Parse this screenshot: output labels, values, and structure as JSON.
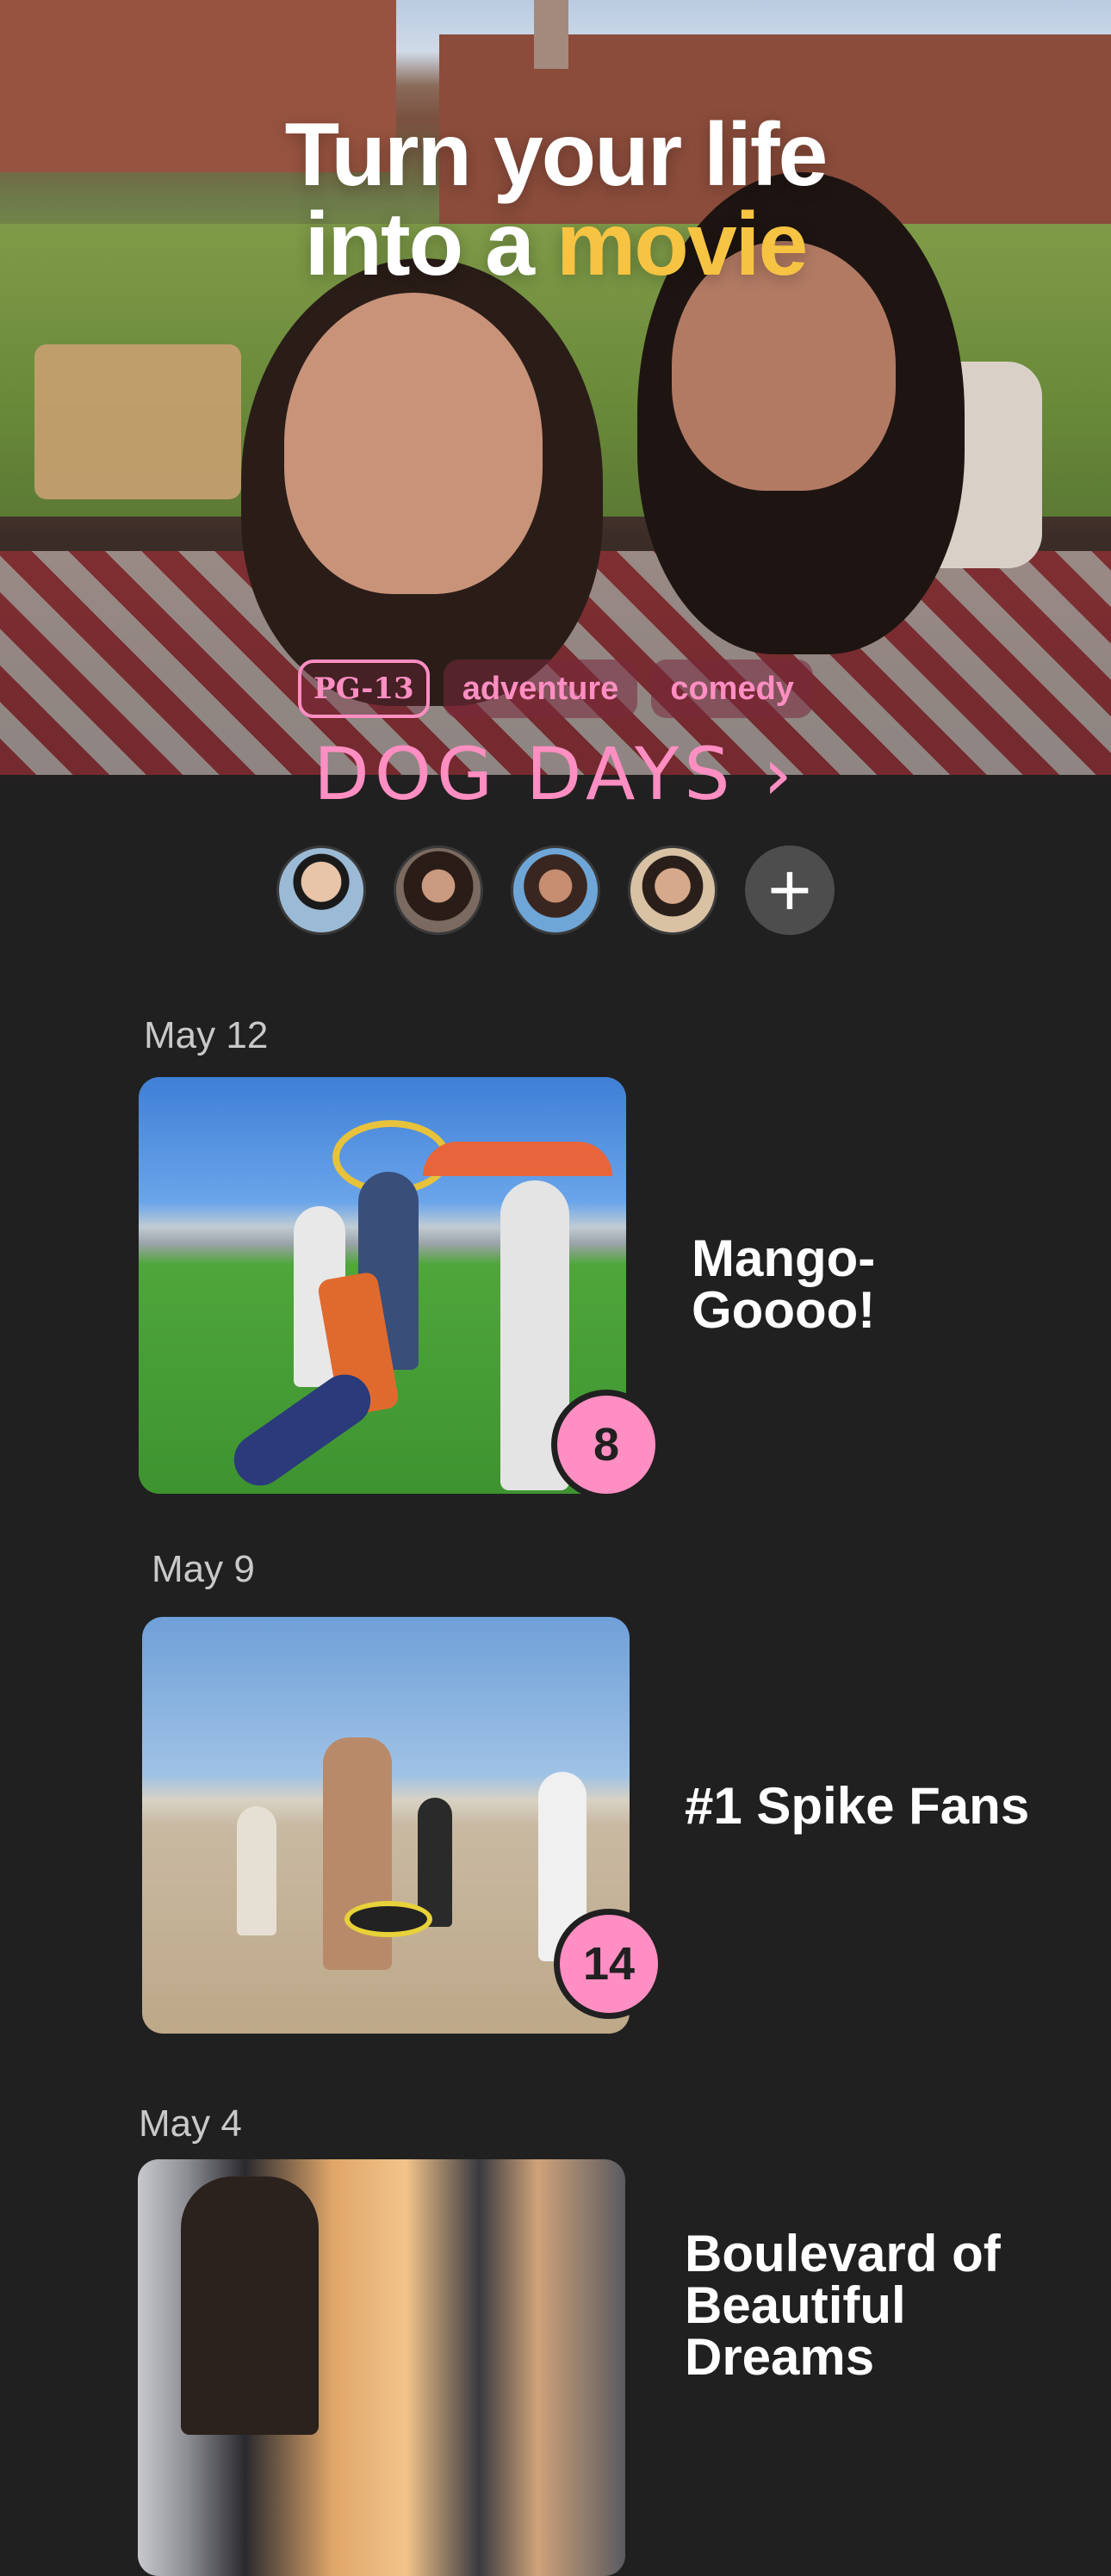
{
  "hero": {
    "title_line1": "Turn your life",
    "title_line2_prefix": "into a ",
    "title_line2_accent": "movie",
    "accent_color": "#f6c343"
  },
  "tags": {
    "rating": "PG-13",
    "genre1": "adventure",
    "genre2": "comedy",
    "tag_color": "#ff8ec2"
  },
  "movie": {
    "title": "DOG DAYS ›"
  },
  "cast": {
    "add_icon": "plus-icon",
    "add_glyph": "+"
  },
  "entries": [
    {
      "date": "May 12",
      "title": "Mango-Goooo!",
      "count": "8"
    },
    {
      "date": "May 9",
      "title": "#1 Spike Fans",
      "count": "14"
    },
    {
      "date": "May 4",
      "title": "Boulevard of Beautiful Dreams"
    }
  ],
  "badge_color": "#ff8ec2",
  "background_color": "#202020"
}
